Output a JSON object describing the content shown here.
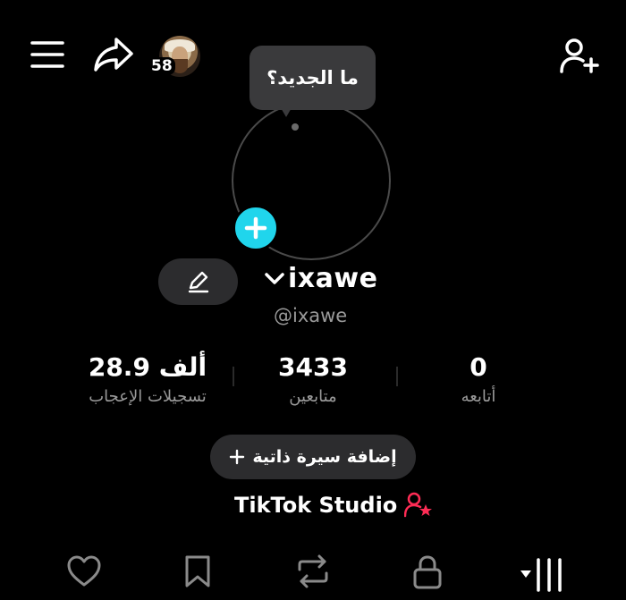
{
  "header": {
    "notification_count": "58"
  },
  "whats_new": {
    "label": "ما الجديد؟"
  },
  "profile": {
    "username": "ixawe",
    "handle": "@ixawe"
  },
  "stats": {
    "likes": {
      "value": "28.9 ألف",
      "label": "تسجيلات الإعجاب"
    },
    "followers": {
      "value": "3433",
      "label": "متابعين"
    },
    "following": {
      "value": "0",
      "label": "أتابعه"
    }
  },
  "bio": {
    "add_label": "إضافة سيرة ذاتية"
  },
  "studio": {
    "label": "TikTok Studio"
  },
  "colors": {
    "accent_cyan": "#20d5ec",
    "accent_pink": "#fe2c55",
    "pill_bg": "#2c2c2e"
  },
  "tabs": [
    {
      "icon": "heart-icon"
    },
    {
      "icon": "bookmark-icon"
    },
    {
      "icon": "repost-icon"
    },
    {
      "icon": "lock-icon"
    },
    {
      "icon": "videos-grid-icon"
    }
  ]
}
